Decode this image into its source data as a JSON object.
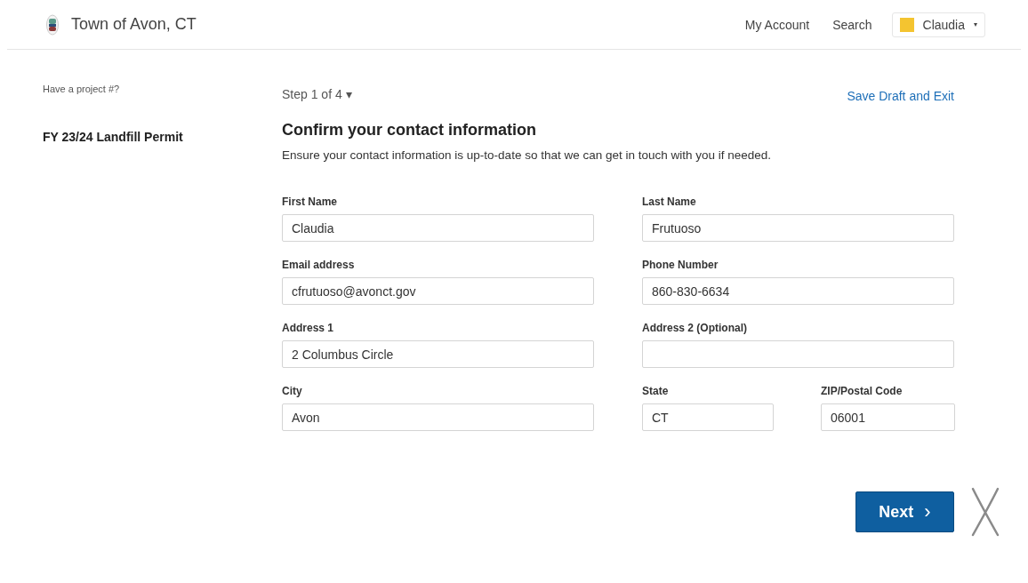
{
  "header": {
    "site_title": "Town of Avon, CT",
    "nav": [
      "My Account",
      "Search"
    ],
    "user_menu": {
      "label": "Claudia",
      "caret": "▾"
    }
  },
  "sidebar": {
    "project_prompt": "Have a project #?",
    "permit_title": "FY 23/24 Landfill Permit"
  },
  "step": {
    "label": "Step 1 of 4",
    "caret": "▾"
  },
  "save_link": "Save Draft and Exit",
  "form": {
    "title": "Confirm your contact information",
    "description": "Ensure your contact information is up-to-date so that we can get in touch with you if needed.",
    "rows": [
      [
        {
          "label": "First Name",
          "value": "Claudia"
        },
        {
          "label": "Last Name",
          "value": "Frutuoso"
        }
      ],
      [
        {
          "label": "Email address",
          "value": "cfrutuoso@avonct.gov"
        },
        {
          "label": "Phone Number",
          "value": "860-830-6634"
        }
      ],
      [
        {
          "label": "Address 1",
          "value": "2 Columbus Circle"
        },
        {
          "label": "Address 2 (Optional)"
        }
      ],
      [
        {
          "label": "City",
          "value": "Avon"
        },
        {
          "label": "State",
          "value": "CT"
        },
        {
          "label": "ZIP/Postal Code",
          "value": "06001"
        }
      ]
    ]
  },
  "next_button": {
    "label": "Next",
    "icon": "›"
  }
}
